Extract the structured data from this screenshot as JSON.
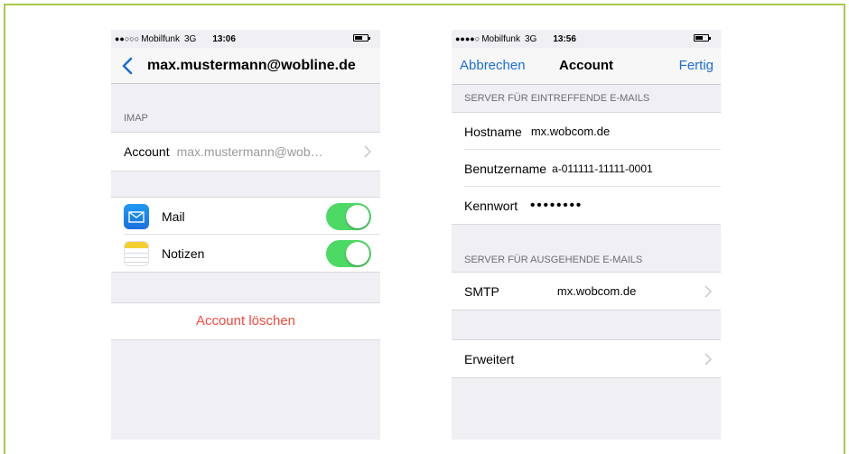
{
  "phone_left": {
    "status": {
      "signal": "●●○○○",
      "carrier": "Mobilfunk",
      "network": "3G",
      "time": "13:06"
    },
    "nav": {
      "title": "max.mustermann@wobline.de"
    },
    "imap_header": "IMAP",
    "account_row": {
      "label": "Account",
      "value": "max.mustermann@wob…"
    },
    "mail_row": {
      "label": "Mail",
      "enabled": true
    },
    "notes_row": {
      "label": "Notizen",
      "enabled": true
    },
    "delete_label": "Account löschen"
  },
  "phone_right": {
    "status": {
      "signal": "●●●●○",
      "carrier": "Mobilfunk",
      "network": "3G",
      "time": "13:56"
    },
    "nav": {
      "cancel": "Abbrechen",
      "title": "Account",
      "done": "Fertig"
    },
    "incoming_header": "SERVER FÜR EINTREFFENDE E-MAILS",
    "hostname": {
      "label": "Hostname",
      "value": "mx.wobcom.de"
    },
    "username": {
      "label": "Benutzername",
      "value": "a-011111-11111-0001"
    },
    "password": {
      "label": "Kennwort",
      "value": "••••••••"
    },
    "outgoing_header": "SERVER FÜR AUSGEHENDE E-MAILS",
    "smtp": {
      "label": "SMTP",
      "value": "mx.wobcom.de"
    },
    "advanced": {
      "label": "Erweitert"
    }
  },
  "colors": {
    "accent": "#1a6dd8",
    "toggle_on": "#4cd964",
    "destructive": "#f24b3f",
    "frame": "#a9c94a"
  }
}
